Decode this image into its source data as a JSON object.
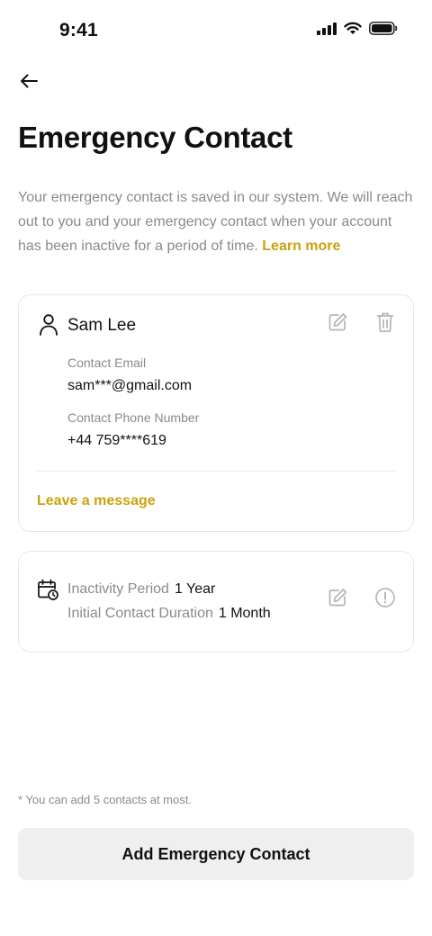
{
  "status_bar": {
    "time": "9:41",
    "icons": [
      "signal-icon",
      "wifi-icon",
      "battery-icon"
    ]
  },
  "header": {
    "back_icon": "arrow-left-icon",
    "title": "Emergency Contact"
  },
  "intro": {
    "text": "Your emergency contact is saved in our system. We will reach out to you and your emergency contact when your account has been inactive for a period of time.",
    "link_label": "Learn more"
  },
  "contact_card": {
    "name": "Sam Lee",
    "email_label": "Contact Email",
    "email_value": "sam***@gmail.com",
    "phone_label": "Contact Phone Number",
    "phone_value": "+44 759****619",
    "message_link": "Leave a message",
    "icons": [
      "person-icon",
      "edit-icon",
      "trash-icon"
    ]
  },
  "inactivity_card": {
    "period_label": "Inactivity Period",
    "period_value": "1 Year",
    "duration_label": "Initial Contact Duration",
    "duration_value": "1 Month",
    "icons": [
      "calendar-clock-icon",
      "edit-icon",
      "info-icon"
    ]
  },
  "footer": {
    "note": "* You can add 5 contacts at most.",
    "add_button_label": "Add Emergency Contact"
  },
  "colors": {
    "accent": "#c9a20e",
    "muted_text": "#8a8a8a",
    "icon_gray": "#b5b5b5",
    "button_bg": "#efefef"
  }
}
